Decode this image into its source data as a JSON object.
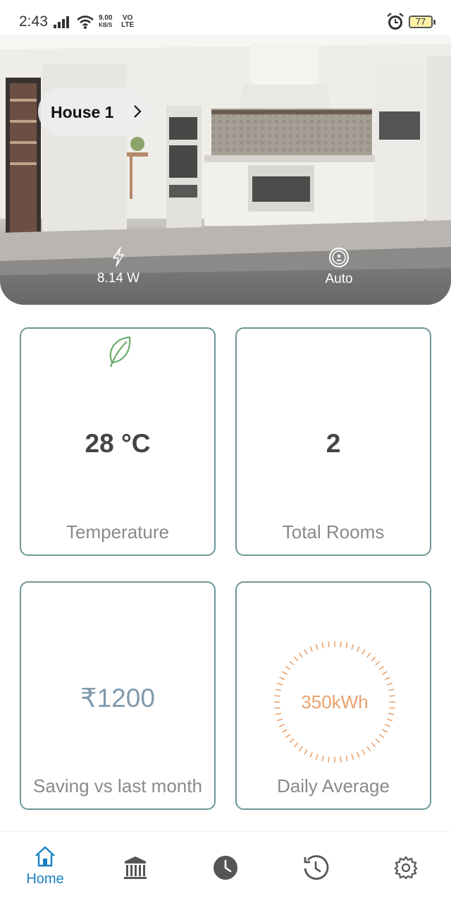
{
  "status_bar": {
    "time": "2:43",
    "net_speed_value": "9.00",
    "net_speed_unit": "KB/S",
    "net_type_top": "VO",
    "net_type_bottom": "LTE",
    "battery": "77"
  },
  "hero": {
    "house_name": "House 1",
    "power": "8.14 W",
    "mode": "Auto"
  },
  "cards": {
    "temperature": {
      "value": "28 °C",
      "label": "Temperature"
    },
    "rooms": {
      "value": "2",
      "label": "Total Rooms"
    },
    "saving": {
      "value": "₹1200",
      "label": "Saving vs last month"
    },
    "daily": {
      "value": "350kWh",
      "label": "Daily Average"
    }
  },
  "colors": {
    "card_border": "#6e9696",
    "accent_blue": "#1a7fc4",
    "leaf_green": "#6cab6e",
    "gauge_orange": "#e9a26e",
    "saving_blue": "#7f99ad"
  },
  "icons": {
    "status": [
      "signal-icon",
      "wifi-icon",
      "alarm-icon",
      "battery-icon"
    ],
    "hero": [
      "chevron-right-icon",
      "bolt-icon",
      "robot-vacuum-icon"
    ],
    "cards": [
      "leaf-icon"
    ],
    "nav": [
      "home-icon",
      "building-icon",
      "clock-icon",
      "history-icon",
      "gear-icon"
    ]
  },
  "nav": {
    "items": [
      {
        "id": "home",
        "label": "Home",
        "active": true
      },
      {
        "id": "buildings",
        "label": "",
        "active": false
      },
      {
        "id": "schedule",
        "label": "",
        "active": false
      },
      {
        "id": "history",
        "label": "",
        "active": false
      },
      {
        "id": "settings",
        "label": "",
        "active": false
      }
    ]
  }
}
